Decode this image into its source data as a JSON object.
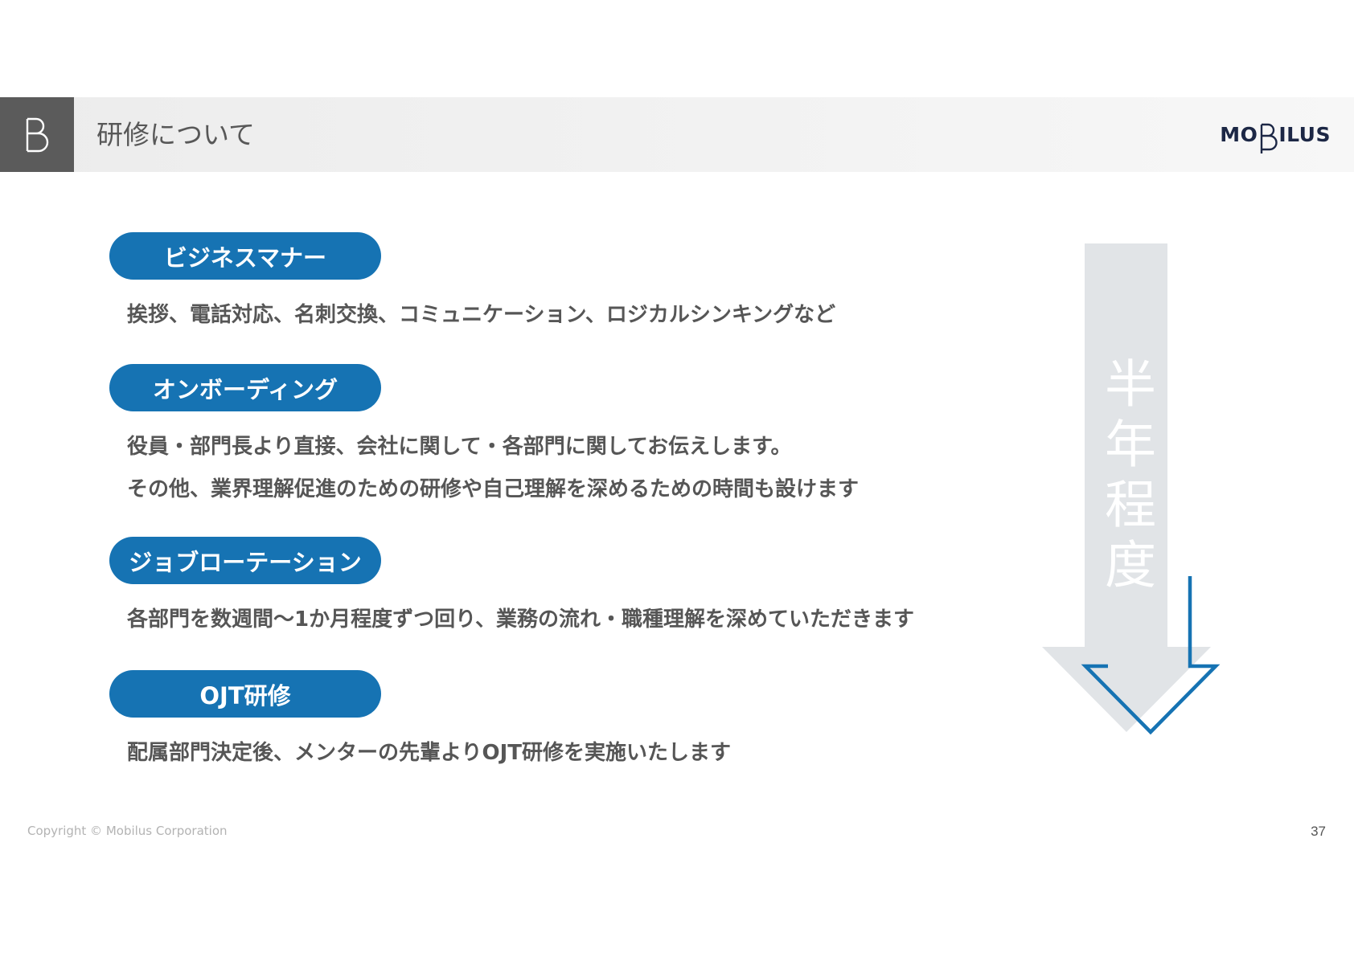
{
  "header": {
    "title": "研修について",
    "logo": {
      "prefix": "MO",
      "suffix": "ILUS"
    }
  },
  "sections": [
    {
      "label": "ビジネスマナー",
      "lines": [
        "挨拶、電話対応、名刺交換、コミュニケーション、ロジカルシンキングなど"
      ]
    },
    {
      "label": "オンボーディング",
      "lines": [
        "役員・部門長より直接、会社に関して・各部門に関してお伝えします。",
        "その他、業界理解促進のための研修や自己理解を深めるための時間も設けます"
      ]
    },
    {
      "label": "ジョブローテーション",
      "lines": [
        "各部門を数週間～1か月程度ずつ回り、業務の流れ・職種理解を深めていただきます"
      ]
    },
    {
      "label": "OJT研修",
      "lines": [
        "配属部門決定後、メンターの先輩よりOJT研修を実施いたします"
      ]
    }
  ],
  "timeline": {
    "label": "半年程度"
  },
  "footer": {
    "copyright": "Copyright © Mobilus Corporation",
    "page_number": "37"
  },
  "colors": {
    "accent": "#1673b3",
    "arrow_fill": "#e1e4e7",
    "header_mark": "#5b5b5b",
    "logo": "#1c2745"
  }
}
